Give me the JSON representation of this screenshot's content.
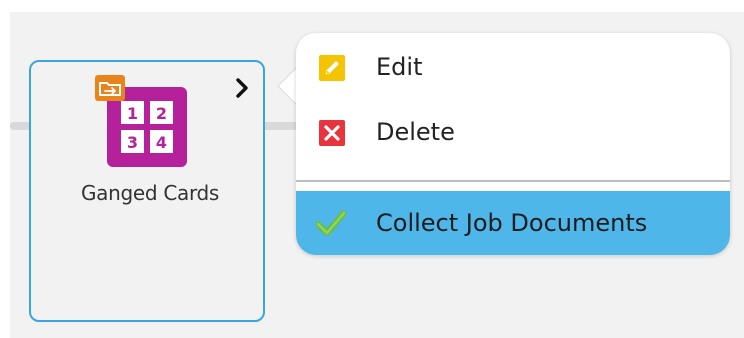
{
  "step": {
    "label": "Ganged Cards",
    "icon_glyphs": [
      "1",
      "2",
      "3",
      "4"
    ],
    "selected": true
  },
  "context_menu": {
    "items": [
      {
        "label": "Edit",
        "icon": "pencil-icon"
      },
      {
        "label": "Delete",
        "icon": "close-icon"
      },
      {
        "label": "Collect Job Documents",
        "icon": "checkmark-icon",
        "highlighted": true
      }
    ]
  },
  "colors": {
    "selection_border": "#3aa4e2",
    "highlight": "#4fb6ea",
    "step_icon": "#b5219a",
    "badge": "#e9841a",
    "edit_icon": "#f5c400",
    "delete_icon": "#e8343c",
    "check_icon": "#6abf3b"
  }
}
